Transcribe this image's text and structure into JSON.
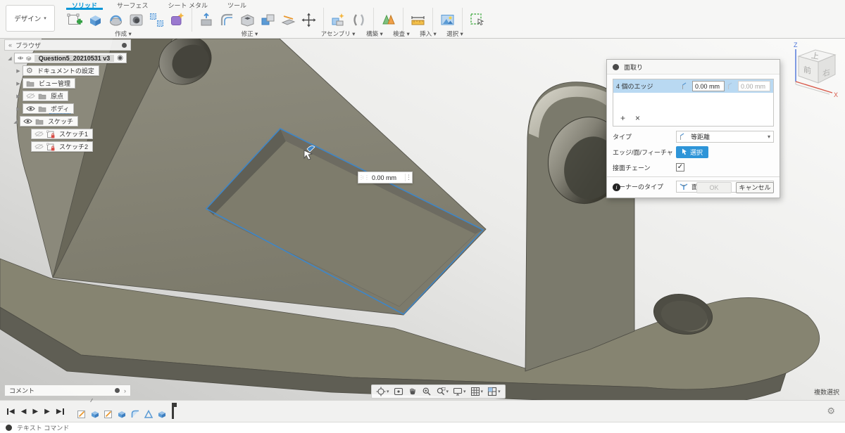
{
  "ribbon": {
    "workspace_label": "デザイン",
    "caret": "▾",
    "tabs": [
      {
        "label": "ソリッド",
        "active": true
      },
      {
        "label": "サーフェス",
        "active": false
      },
      {
        "label": "シート メタル",
        "active": false
      },
      {
        "label": "ツール",
        "active": false
      }
    ],
    "groups": [
      {
        "label": "作成 ▾"
      },
      {
        "label": "修正 ▾"
      },
      {
        "label": "アセンブリ ▾"
      },
      {
        "label": "構築 ▾"
      },
      {
        "label": "検査 ▾"
      },
      {
        "label": "挿入 ▾"
      },
      {
        "label": "選択 ▾"
      }
    ],
    "icons": [
      "create-sketch",
      "extrude",
      "revolve",
      "hole",
      "rectangular-pattern",
      "create-form",
      "press-pull",
      "fillet",
      "shell",
      "combine",
      "split-body",
      "move-copy",
      "new-component",
      "joint",
      "construction-plane",
      "measure",
      "insert-image",
      "window-select"
    ]
  },
  "browser": {
    "title": "ブラウザ",
    "collapse_glyph": "«",
    "root": {
      "label": "Question5_20210531 v3",
      "target_glyph": "◉"
    },
    "items": [
      {
        "label": "ドキュメントの設定",
        "icon": "gear"
      },
      {
        "label": "ビュー管理",
        "icon": "folder"
      },
      {
        "label": "原点",
        "icon": "folder",
        "visible": false
      },
      {
        "label": "ボディ",
        "icon": "folder",
        "visible": true
      },
      {
        "label": "スケッチ",
        "icon": "folder",
        "visible": true
      },
      {
        "label": "スケッチ1",
        "icon": "sketch-locked",
        "visible": false
      },
      {
        "label": "スケッチ2",
        "icon": "sketch-locked",
        "visible": false
      }
    ],
    "expanded_glyph": "◢",
    "collapsed_glyph": "▶"
  },
  "dialog": {
    "title": "面取り",
    "selection_row": {
      "label": "4 個のエッジ",
      "distance1": "0.00 mm",
      "distance2": "0.00 mm"
    },
    "add_glyph": "+",
    "remove_glyph": "×",
    "fields": {
      "type_label": "タイプ",
      "type_value": "等距離",
      "edges_label": "エッジ/面/フィーチャ",
      "select_button": "選択",
      "chain_label": "接面チェーン",
      "chain_checked": true,
      "check_glyph": "✓",
      "corner_label": "コーナーのタイプ",
      "corner_value": "面取り",
      "caret": "▾"
    },
    "ok_label": "OK",
    "cancel_label": "キャンセル"
  },
  "canvas": {
    "dimension_value": "0.00 mm",
    "selection_hint": "複数選択",
    "selected_edge_color": "#3e86c8",
    "body_color": "#83816f",
    "grip_glyph": "⋮⋮",
    "menu_glyph": "⋮"
  },
  "viewcube": {
    "top": "上",
    "front": "前",
    "right": "右",
    "axis_z": "Z",
    "axis_x": "X"
  },
  "panels": {
    "comments_label": "コメント",
    "text_command_label": "テキスト コマンド",
    "chevron": "›"
  },
  "timeline": {
    "features": [
      "sketch",
      "extrude",
      "sketch",
      "extrude",
      "fillet",
      "draft",
      "extrude"
    ],
    "playback": [
      "skip-to-start",
      "step-back",
      "play",
      "step-forward",
      "skip-to-end"
    ],
    "gear_glyph": "⚙",
    "hatch_glyph": "⁄⁄⁄"
  },
  "accent": {
    "tab_blue": "#0696d7",
    "select_blue": "#2e95d8",
    "row_highlight": "#b9d9f2"
  }
}
